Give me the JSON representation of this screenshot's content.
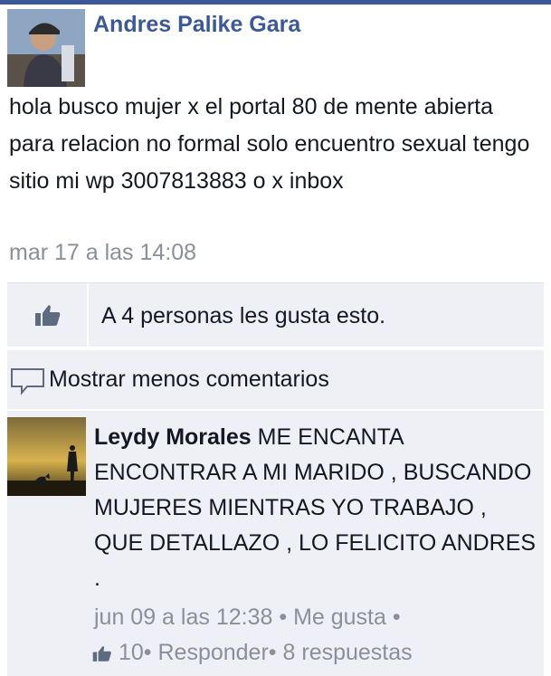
{
  "post": {
    "author": "Andres Palike Gara",
    "text": "hola busco mujer x el portal 80 de mente abierta para relacion no formal solo encuentro sexual tengo sitio mi wp 3007813883 o x inbox",
    "timestamp": "mar 17 a las 14:08"
  },
  "likes": {
    "text": "A 4 personas les gusta esto."
  },
  "comments_toggle": {
    "label": "Mostrar menos comentarios"
  },
  "comment": {
    "author": "Leydy Morales",
    "text": "ME ENCANTA ENCONTRAR A MI MARIDO , BUSCANDO MUJERES MIENTRAS YO TRABAJO , QUE DETALLAZO , LO FELICITO ANDRES .",
    "timestamp": "jun 09 a las 12:38",
    "separator": "•",
    "like_label": "Me gusta",
    "like_count": "10",
    "reply_label": "Responder",
    "replies_label": "8 respuestas"
  },
  "colors": {
    "brand": "#3b5998",
    "meta_text": "#8a8f99",
    "panel_bg": "#eef0f5"
  },
  "icons": {
    "like": "thumbs-up-icon",
    "comment": "speech-bubble-icon"
  }
}
